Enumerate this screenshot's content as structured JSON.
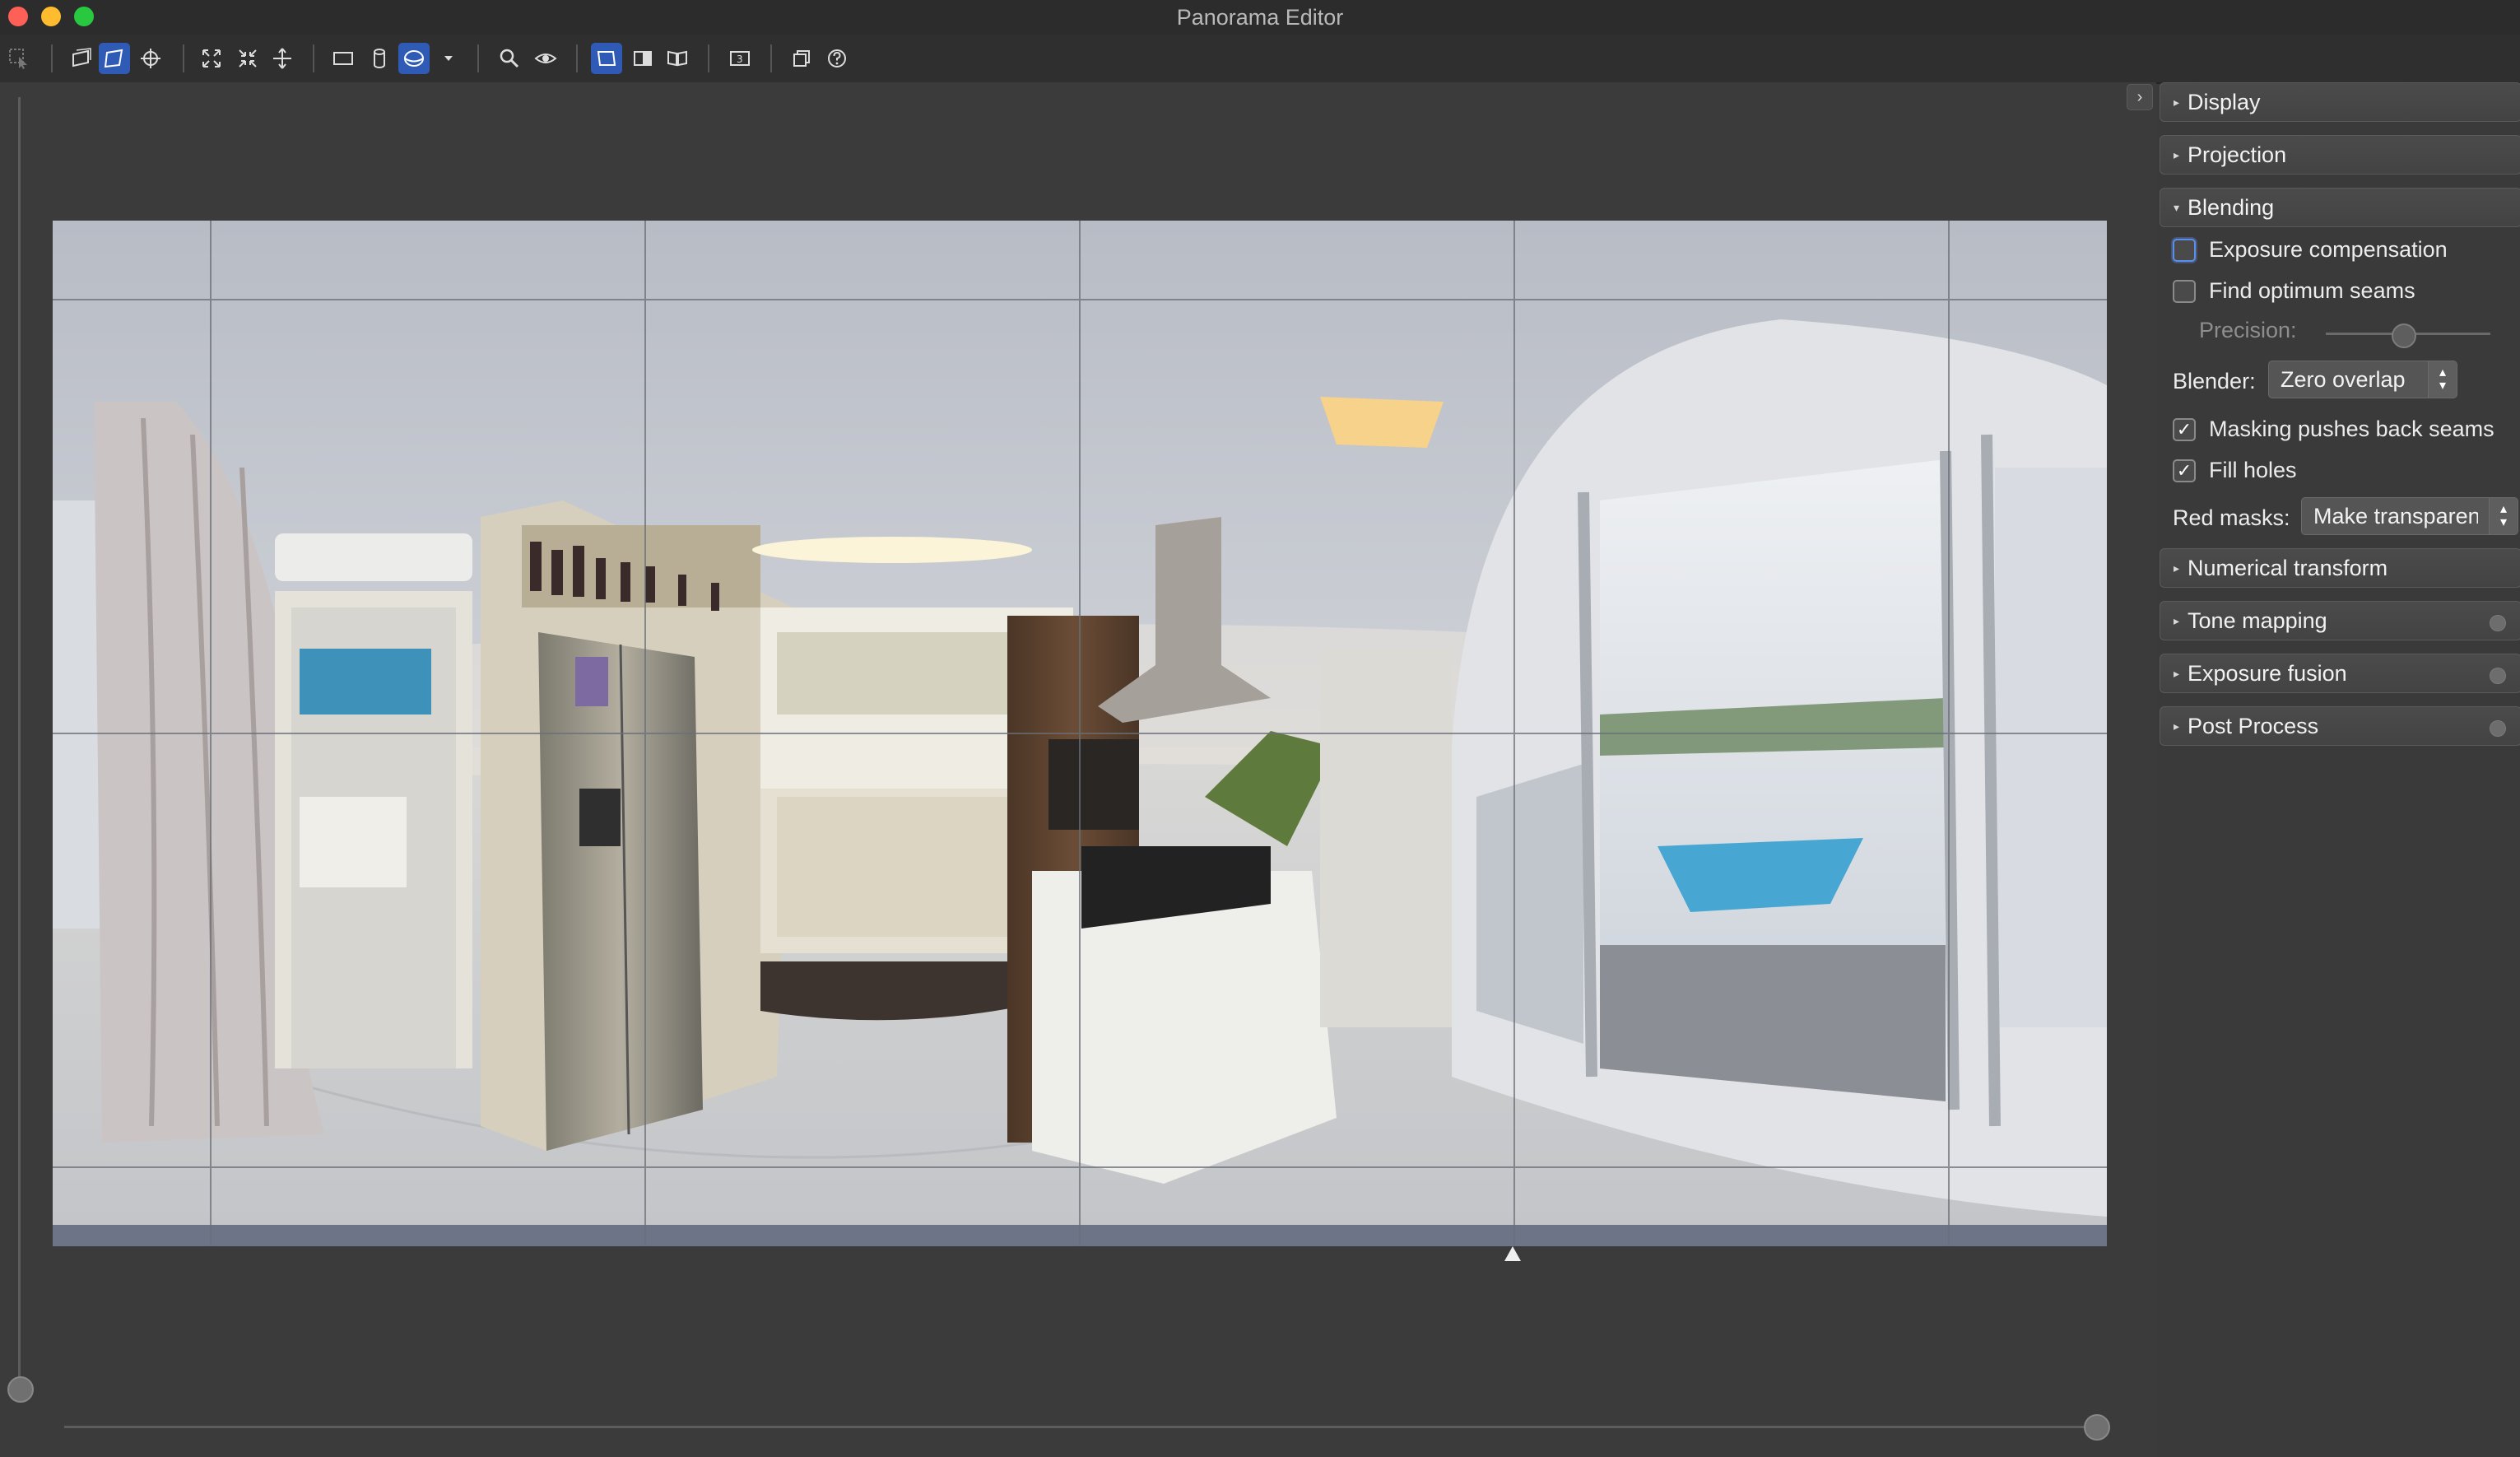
{
  "window": {
    "title": "Panorama Editor"
  },
  "toolbar": {
    "items": [
      {
        "name": "select-tool-icon",
        "active": false
      },
      {
        "name": "fit-panorama-icon",
        "active": false
      },
      {
        "name": "drag-panorama-icon",
        "active": true
      },
      {
        "name": "crosshair-icon",
        "active": false
      },
      {
        "name": "expand-icon",
        "active": false
      },
      {
        "name": "shrink-icon",
        "active": false
      },
      {
        "name": "straighten-icon",
        "active": false
      },
      {
        "name": "rectilinear-projection-icon",
        "active": false
      },
      {
        "name": "cylindrical-projection-icon",
        "active": false
      },
      {
        "name": "spherical-projection-icon",
        "active": true
      },
      {
        "name": "dropdown-arrow-icon",
        "active": false
      },
      {
        "name": "zoom-icon",
        "active": false
      },
      {
        "name": "preview-eye-icon",
        "active": false
      },
      {
        "name": "view-mode-normal-icon",
        "active": true
      },
      {
        "name": "view-mode-split-icon",
        "active": false
      },
      {
        "name": "view-mode-book-icon",
        "active": false
      },
      {
        "name": "stereo-3d-icon",
        "active": false
      },
      {
        "name": "layers-icon",
        "active": false
      },
      {
        "name": "help-icon",
        "active": false
      }
    ]
  },
  "panel": {
    "sections": {
      "display": "Display",
      "projection": "Projection",
      "blending": "Blending",
      "numerical_transform": "Numerical transform",
      "tone_mapping": "Tone mapping",
      "exposure_fusion": "Exposure fusion",
      "post_process": "Post Process"
    },
    "blending": {
      "exposure_compensation": {
        "label": "Exposure compensation",
        "checked": false
      },
      "find_optimum_seams": {
        "label": "Find optimum seams",
        "checked": false
      },
      "precision": {
        "label": "Precision:",
        "value": 0.5
      },
      "blender": {
        "label": "Blender:",
        "value": "Zero overlap"
      },
      "masking_pushes_back_seams": {
        "label": "Masking pushes back seams",
        "checked": true
      },
      "fill_holes": {
        "label": "Fill holes",
        "checked": true
      },
      "red_masks": {
        "label": "Red masks:",
        "value": "Make transparent"
      }
    },
    "checkmark": "✓",
    "collapse_glyph": "›"
  },
  "colors": {
    "accent": "#2f5bb6",
    "background": "#3a3a3a"
  }
}
